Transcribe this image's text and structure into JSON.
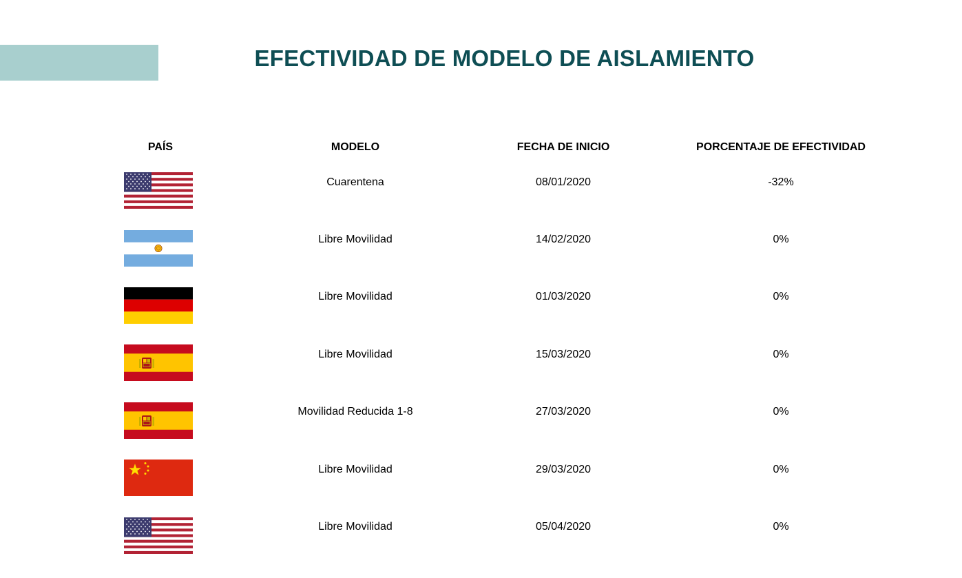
{
  "title": "EFECTIVIDAD DE MODELO DE AISLAMIENTO",
  "colors": {
    "accent_bar": "#a8cfce",
    "title": "#0e4e54"
  },
  "columns": {
    "pais": "PAÍS",
    "modelo": "MODELO",
    "fecha": "FECHA DE INICIO",
    "porcentaje": "PORCENTAJE DE EFECTIVIDAD"
  },
  "rows": [
    {
      "flag": "usa-flag-icon",
      "modelo": "Cuarentena",
      "fecha": "08/01/2020",
      "porcentaje": "-32%"
    },
    {
      "flag": "argentina-flag-icon",
      "modelo": "Libre Movilidad",
      "fecha": "14/02/2020",
      "porcentaje": "0%"
    },
    {
      "flag": "germany-flag-icon",
      "modelo": "Libre Movilidad",
      "fecha": "01/03/2020",
      "porcentaje": "0%"
    },
    {
      "flag": "spain-flag-icon",
      "modelo": "Libre Movilidad",
      "fecha": "15/03/2020",
      "porcentaje": "0%"
    },
    {
      "flag": "spain-flag-icon",
      "modelo": "Movilidad Reducida 1-8",
      "fecha": "27/03/2020",
      "porcentaje": "0%"
    },
    {
      "flag": "china-flag-icon",
      "modelo": "Libre Movilidad",
      "fecha": "29/03/2020",
      "porcentaje": "0%"
    },
    {
      "flag": "usa-flag-icon",
      "modelo": "Libre Movilidad",
      "fecha": "05/04/2020",
      "porcentaje": "0%"
    }
  ]
}
